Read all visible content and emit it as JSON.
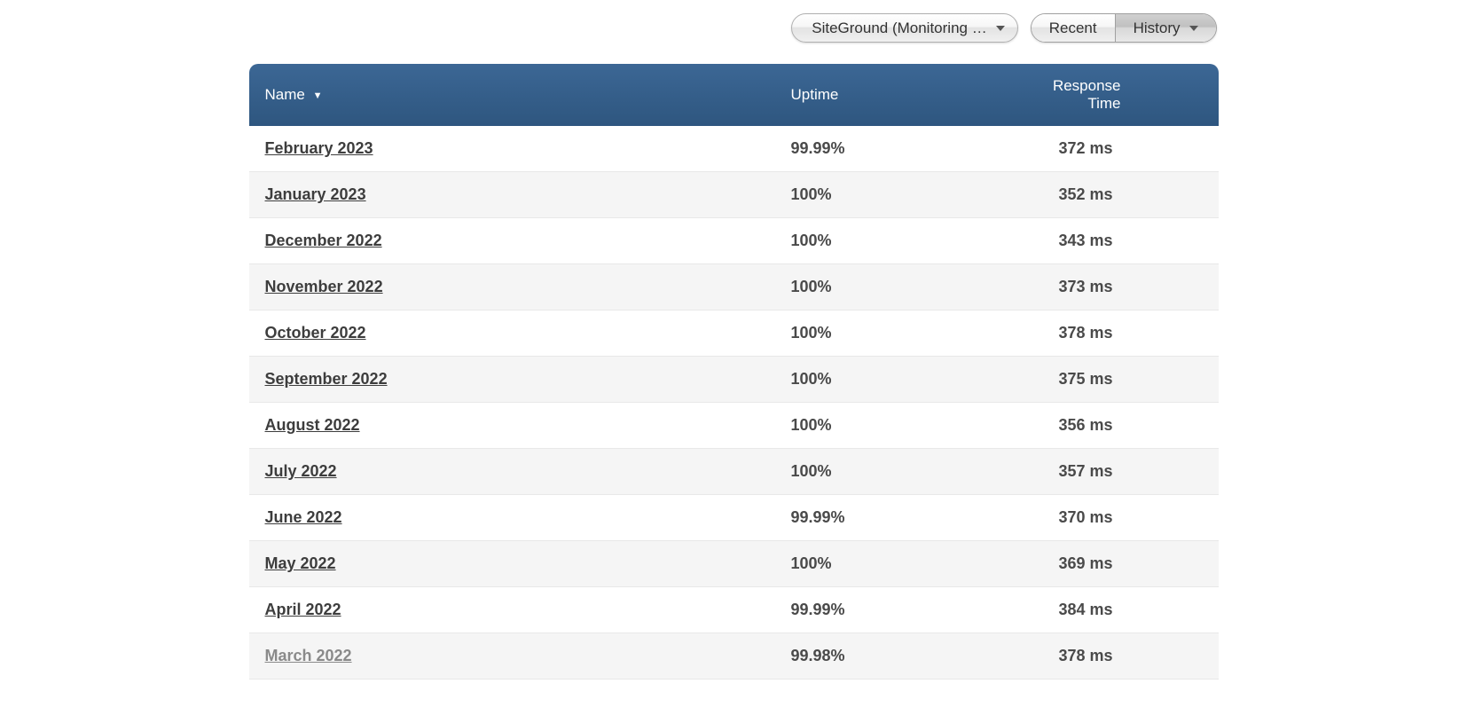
{
  "toolbar": {
    "site_dropdown_label": "SiteGround (Monitoring …",
    "recent_label": "Recent",
    "history_label": "History"
  },
  "table": {
    "columns": {
      "name": "Name",
      "uptime": "Uptime",
      "response": "Response Time"
    },
    "sort_indicator": "▼",
    "rows": [
      {
        "name": "February 2023",
        "uptime": "99.99%",
        "response": "372 ms",
        "muted": false
      },
      {
        "name": "January 2023",
        "uptime": "100%",
        "response": "352 ms",
        "muted": false
      },
      {
        "name": "December 2022",
        "uptime": "100%",
        "response": "343 ms",
        "muted": false
      },
      {
        "name": "November 2022",
        "uptime": "100%",
        "response": "373 ms",
        "muted": false
      },
      {
        "name": "October 2022",
        "uptime": "100%",
        "response": "378 ms",
        "muted": false
      },
      {
        "name": "September 2022",
        "uptime": "100%",
        "response": "375 ms",
        "muted": false
      },
      {
        "name": "August 2022",
        "uptime": "100%",
        "response": "356 ms",
        "muted": false
      },
      {
        "name": "July 2022",
        "uptime": "100%",
        "response": "357 ms",
        "muted": false
      },
      {
        "name": "June 2022",
        "uptime": "99.99%",
        "response": "370 ms",
        "muted": false
      },
      {
        "name": "May 2022",
        "uptime": "100%",
        "response": "369 ms",
        "muted": false
      },
      {
        "name": "April 2022",
        "uptime": "99.99%",
        "response": "384 ms",
        "muted": false
      },
      {
        "name": "March 2022",
        "uptime": "99.98%",
        "response": "378 ms",
        "muted": true
      }
    ]
  }
}
